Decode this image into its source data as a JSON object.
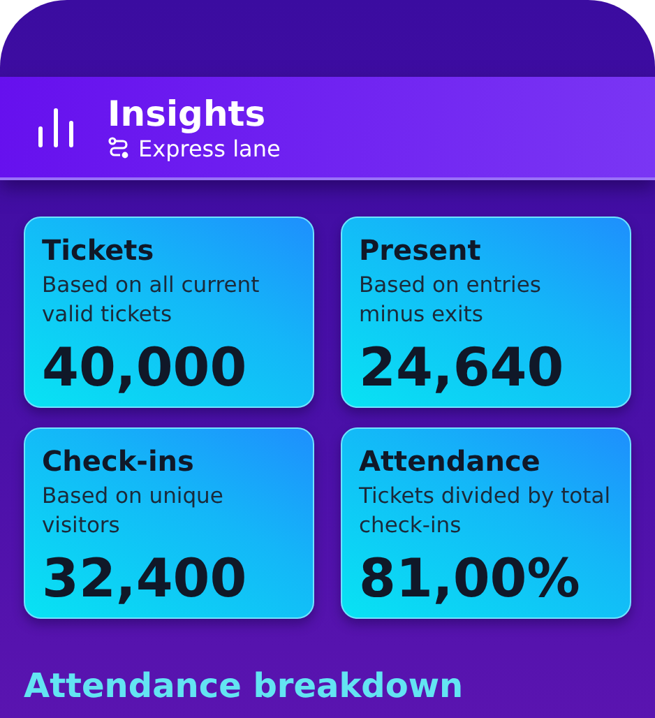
{
  "header": {
    "title": "Insights",
    "subtitle": "Express lane"
  },
  "cards": [
    {
      "title": "Tickets",
      "description": "Based on all current valid tickets",
      "value": "40,000"
    },
    {
      "title": "Present",
      "description": "Based on entries minus exits",
      "value": "24,640"
    },
    {
      "title": "Check-ins",
      "description": "Based on unique visitors",
      "value": "32,400"
    },
    {
      "title": "Attendance",
      "description": "Tickets divided by total check-ins",
      "value": "81,00%"
    }
  ],
  "section_heading": "Attendance breakdown"
}
